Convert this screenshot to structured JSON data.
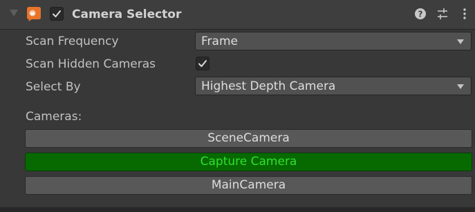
{
  "component": {
    "title": "Camera Selector",
    "icon": "orange-script-icon",
    "enabled": true,
    "header_icons": [
      "help-icon",
      "presets-icon",
      "kebab-menu-icon"
    ]
  },
  "fields": {
    "scan_frequency": {
      "label": "Scan Frequency",
      "value": "Frame"
    },
    "scan_hidden_cameras": {
      "label": "Scan Hidden Cameras",
      "checked": true
    },
    "select_by": {
      "label": "Select By",
      "value": "Highest Depth Camera"
    }
  },
  "cameras": {
    "label": "Cameras:",
    "items": [
      {
        "name": "SceneCamera",
        "selected": false
      },
      {
        "name": "Capture Camera",
        "selected": true
      },
      {
        "name": "MainCamera",
        "selected": false
      }
    ]
  },
  "colors": {
    "selected_bg": "#066a00",
    "selected_text": "#30e030",
    "accent_orange": "#e8742a"
  }
}
